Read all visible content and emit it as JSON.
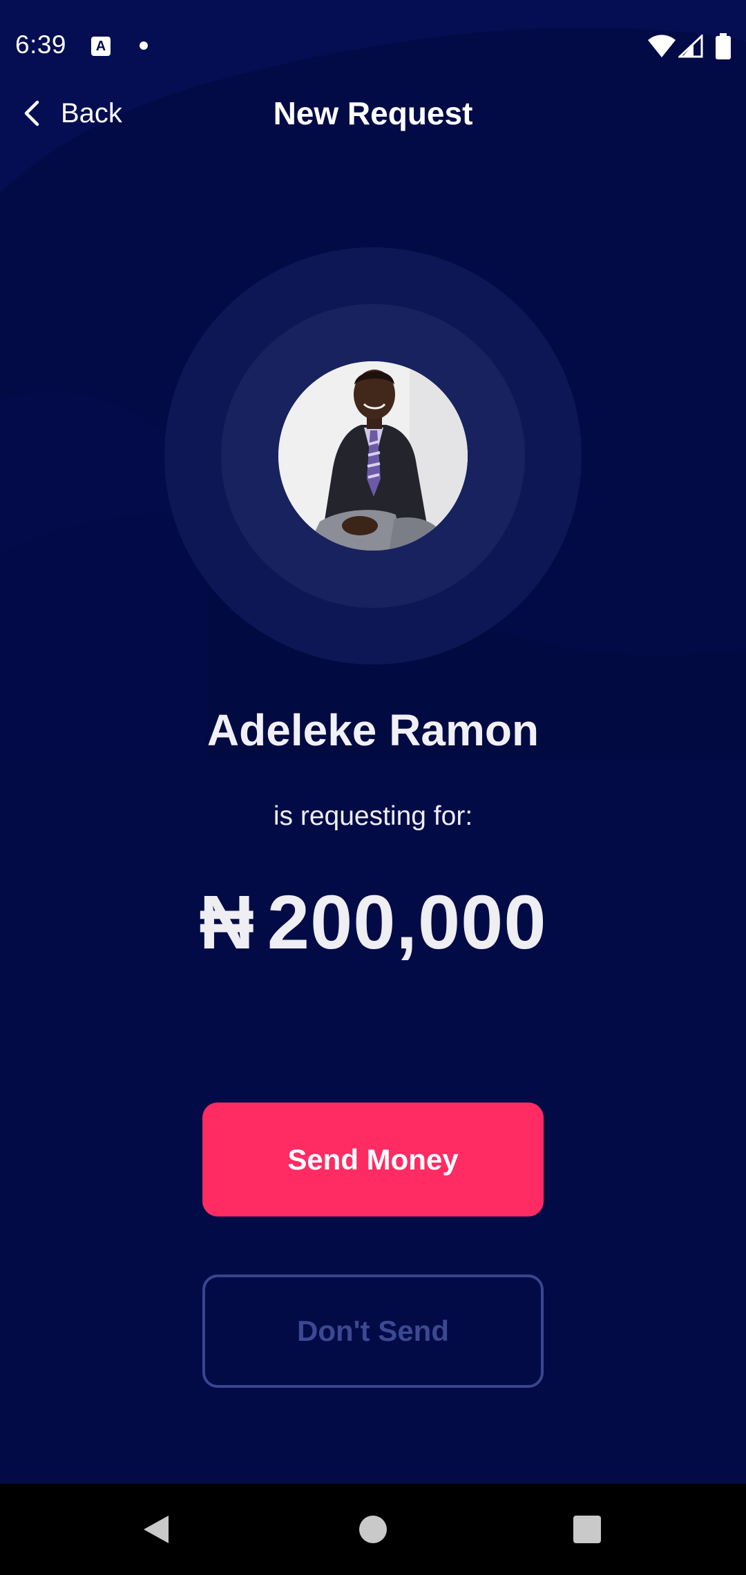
{
  "status_bar": {
    "time": "6:39",
    "notification_icon": "A"
  },
  "header": {
    "back_label": "Back",
    "title": "New Request"
  },
  "request": {
    "requester_name": "Adeleke Ramon",
    "caption": "is requesting for:",
    "currency_symbol": "₦",
    "amount": "200,000"
  },
  "actions": {
    "send_label": "Send Money",
    "dont_send_label": "Don't Send"
  },
  "colors": {
    "background": "#030b46",
    "primary_button": "#ff2b63",
    "secondary_button_border": "#3a4590",
    "secondary_button_text": "#3c4892"
  },
  "icons": {
    "back": "chevron-left-icon",
    "wifi": "wifi-icon",
    "signal": "cell-signal-icon",
    "battery": "battery-icon",
    "nav_back": "triangle-back-icon",
    "nav_home": "circle-home-icon",
    "nav_recents": "square-recents-icon"
  }
}
